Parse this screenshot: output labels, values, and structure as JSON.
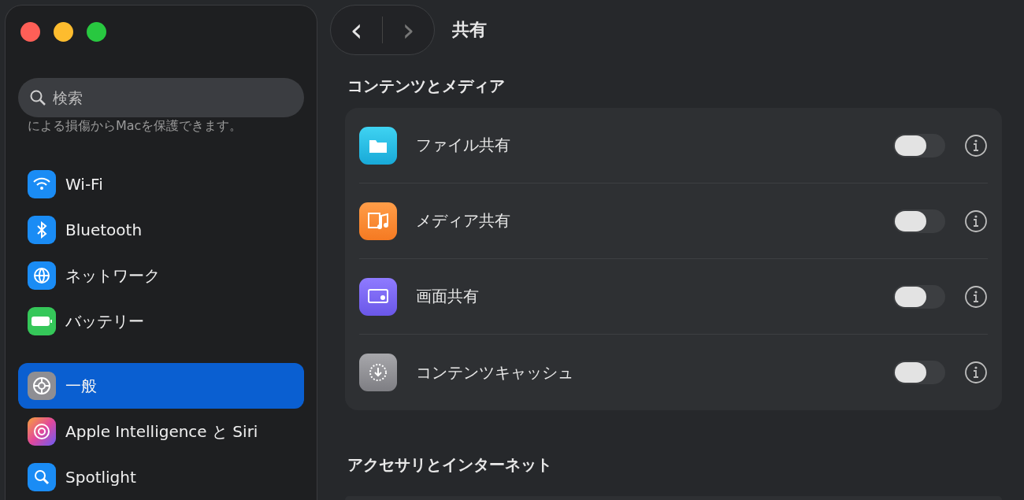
{
  "sidebar": {
    "search": {
      "placeholder": "検索"
    },
    "note": "による損傷からMacを保護できます。",
    "groups": [
      [
        {
          "label": "Wi-Fi",
          "selected": false
        },
        {
          "label": "Bluetooth",
          "selected": false
        },
        {
          "label": "ネットワーク",
          "selected": false
        },
        {
          "label": "バッテリー",
          "selected": false
        }
      ],
      [
        {
          "label": "一般",
          "selected": true
        },
        {
          "label": "Apple Intelligence と Siri",
          "selected": false
        },
        {
          "label": "Spotlight",
          "selected": false
        }
      ]
    ]
  },
  "toolbar": {
    "back": "‹",
    "forward": "›",
    "title": "共有"
  },
  "sections": [
    {
      "heading": "コンテンツとメディア",
      "rows": [
        {
          "label": "ファイル共有",
          "on": false
        },
        {
          "label": "メディア共有",
          "on": false
        },
        {
          "label": "画面共有",
          "on": false
        },
        {
          "label": "コンテンツキャッシュ",
          "on": false
        }
      ]
    },
    {
      "heading": "アクセサリとインターネット"
    }
  ]
}
